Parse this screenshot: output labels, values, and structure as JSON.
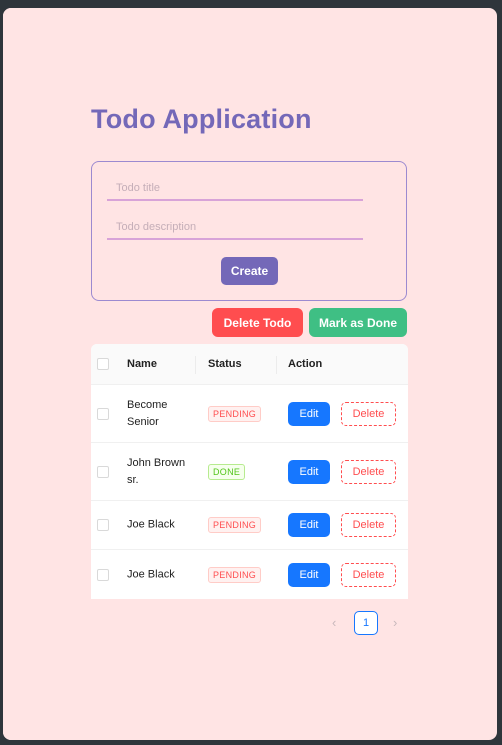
{
  "app": {
    "title": "Todo Application"
  },
  "form": {
    "title_placeholder": "Todo title",
    "description_placeholder": "Todo description",
    "create_label": "Create"
  },
  "bulk_actions": {
    "delete_label": "Delete Todo",
    "mark_done_label": "Mark as Done"
  },
  "table": {
    "headers": {
      "name": "Name",
      "status": "Status",
      "action": "Action"
    },
    "rows": [
      {
        "name": "Become Senior",
        "status": "PENDING",
        "edit": "Edit",
        "delete": "Delete"
      },
      {
        "name": "John Brown sr.",
        "status": "DONE",
        "edit": "Edit",
        "delete": "Delete"
      },
      {
        "name": "Joe Black",
        "status": "PENDING",
        "edit": "Edit",
        "delete": "Delete"
      },
      {
        "name": "Joe Black",
        "status": "PENDING",
        "edit": "Edit",
        "delete": "Delete"
      }
    ]
  },
  "pagination": {
    "current_page": "1",
    "prev_icon": "chevron-left-icon",
    "next_icon": "chevron-right-icon"
  },
  "colors": {
    "page_bg": "#ffe4e4",
    "accent": "#7468b8",
    "danger": "#ff4d4f",
    "success": "#3fbf84",
    "primary": "#1677ff"
  }
}
